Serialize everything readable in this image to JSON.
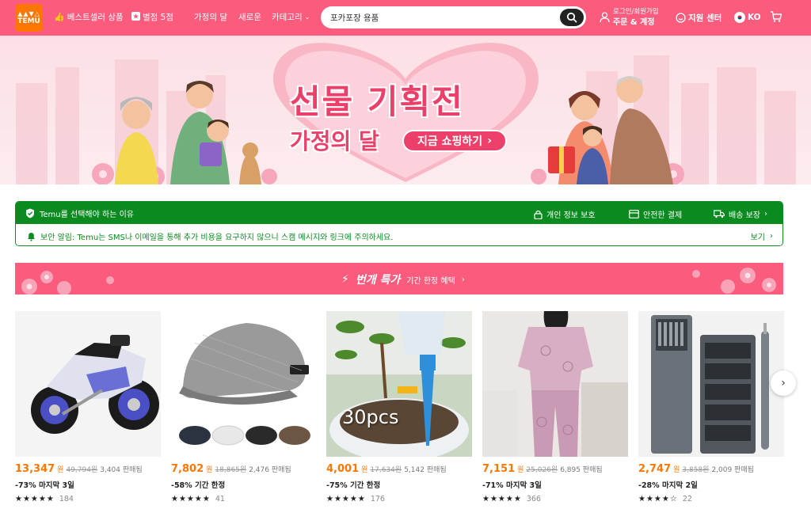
{
  "header": {
    "logo_top": "▲▲▼△",
    "logo_name": "TEMU",
    "nav": [
      {
        "label": "베스트셀러 상품",
        "icon": "thumbs-up-icon"
      },
      {
        "label": "별점 5점",
        "icon": "star-box-icon"
      },
      {
        "label": "가정의 달"
      },
      {
        "label": "새로운"
      },
      {
        "label": "카테고리",
        "icon": "chevron-down-icon"
      }
    ],
    "search_value": "포카포장 용품",
    "account_line1": "로그인/회원가입",
    "account_line2": "주문 & 계정",
    "support": "지원 센터",
    "language": "KO"
  },
  "banner": {
    "title": "선물 기획전",
    "subtitle": "가정의 달",
    "cta": "지금 쇼핑하기"
  },
  "trust": {
    "why": "Temu를 선택해야 하는 이유",
    "features": [
      "개인 정보 보호",
      "안전한 결제",
      "배송 보장"
    ],
    "alert": "보안 알림: Temu는 SMS나 이메일을 통해 추가 비용을 요구하지 않으니 스캠 메시지와 링크에 주의하세요.",
    "view": "보기"
  },
  "deal": {
    "title": "번개 특가",
    "sub": "기간 한정 혜택"
  },
  "products": [
    {
      "price": "13,347",
      "won": "원",
      "orig": "49,794원",
      "sold": "3,404 판매됨",
      "promo": "-73% 마지막 3일",
      "stars": "★★★★★",
      "rating": 5,
      "reviews": "184"
    },
    {
      "price": "7,802",
      "won": "원",
      "orig": "18,865원",
      "sold": "2,476 판매됨",
      "promo": "-58% 기간 한정",
      "stars": "★★★★★",
      "rating": 5,
      "reviews": "41"
    },
    {
      "price": "4,001",
      "won": "원",
      "orig": "17,634원",
      "sold": "5,142 판매됨",
      "promo": "-75% 기간 한정",
      "stars": "★★★★★",
      "rating": 4.5,
      "reviews": "176",
      "image_text": "30pcs"
    },
    {
      "price": "7,151",
      "won": "원",
      "orig": "25,026원",
      "sold": "6,895 판매됨",
      "promo": "-71% 마지막 3일",
      "stars": "★★★★★",
      "rating": 5,
      "reviews": "366"
    },
    {
      "price": "2,747",
      "won": "원",
      "orig": "3,858원",
      "sold": "2,009 판매됨",
      "promo": "-28% 마지막 2일",
      "stars": "★★★★☆",
      "rating": 4.5,
      "reviews": "22"
    }
  ],
  "colors": {
    "brand_pink": "#fb5b7d",
    "brand_orange": "#fb7701",
    "trust_green": "#0a8a1f"
  }
}
